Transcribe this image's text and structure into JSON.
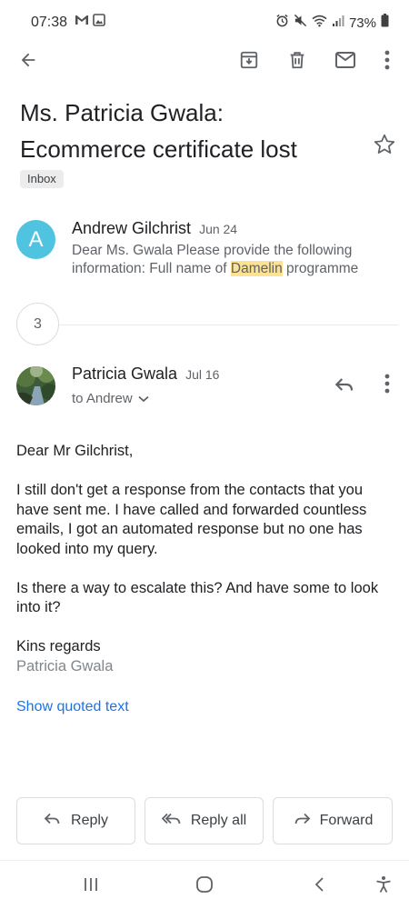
{
  "status_bar": {
    "time": "07:38",
    "battery": "73%",
    "icons_left": [
      "gmail-notification-icon",
      "image-notification-icon"
    ],
    "icons_right": [
      "alarm-icon",
      "mute-icon",
      "wifi-icon",
      "signal-icon",
      "battery-icon"
    ]
  },
  "toolbar": {
    "icons": [
      "back-arrow-icon",
      "archive-icon",
      "delete-icon",
      "mark-unread-icon",
      "more-vert-icon"
    ]
  },
  "email": {
    "subject_line1": "Ms. Patricia Gwala:",
    "subject_line2": "Ecommerce certificate lost",
    "label": "Inbox"
  },
  "messages": [
    {
      "avatar_letter": "A",
      "avatar_color": "#4fc3e0",
      "sender": "Andrew Gilchrist",
      "date": "Jun 24",
      "snippet_before": "Dear Ms. Gwala Please provide the following information: Full name of ",
      "snippet_highlight": "Damelin",
      "snippet_after": " programme"
    },
    {
      "sender": "Patricia Gwala",
      "date": "Jul 16",
      "to": "to Andrew",
      "body": {
        "greeting": "Dear Mr Gilchrist,",
        "para1": "I still don't get a response from the contacts that you have sent me. I have called and forwarded countless emails,  I got an automated response but no one has looked into my query.",
        "para2": "Is there a way to escalate this? And have some to look into it?",
        "closing": "Kins regards",
        "signature": "Patricia Gwala"
      },
      "show_quoted": "Show quoted text"
    }
  ],
  "collapsed_count": "3",
  "actions": {
    "reply": "Reply",
    "reply_all": "Reply all",
    "forward": "Forward"
  },
  "colors": {
    "link": "#1a73e8",
    "highlight": "#fde293"
  }
}
